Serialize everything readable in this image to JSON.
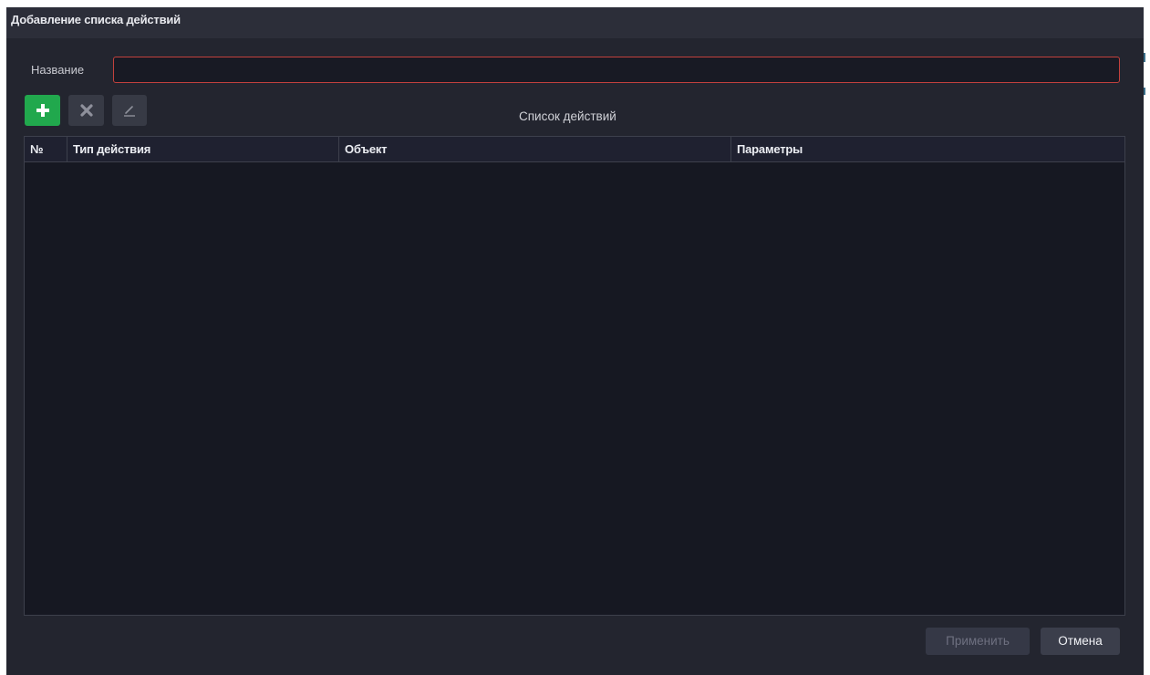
{
  "dialog": {
    "title": "Добавление списка действий"
  },
  "form": {
    "name_label": "Название",
    "name_value": "",
    "name_placeholder": ""
  },
  "toolbar": {
    "add_icon": "plus-icon",
    "delete_icon": "close-icon",
    "edit_icon": "pencil-icon",
    "add_color": "#21a84d"
  },
  "list": {
    "caption": "Список действий",
    "columns": [
      "№",
      "Тип действия",
      "Объект",
      "Параметры"
    ],
    "rows": []
  },
  "buttons": {
    "apply_label": "Применить",
    "cancel_label": "Отмена"
  },
  "colors": {
    "background": "#23252f",
    "titlebar": "#2c2e39",
    "table_bg": "#161822",
    "input_border_error": "#c2413d"
  }
}
